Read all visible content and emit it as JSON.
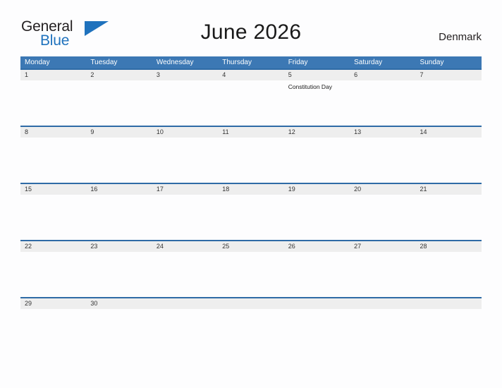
{
  "brand": {
    "line1": "General",
    "line2": "Blue",
    "flag_icon": "blue-flag-triangle-icon",
    "flag_color": "#1f72bd",
    "text_color": "#231f20"
  },
  "header": {
    "title": "June 2026",
    "country": "Denmark"
  },
  "theme": {
    "header_blue": "#3c78b4",
    "row_border_blue": "#2f6ba6",
    "band_gray": "#eeeeee",
    "page_background": "#fdfdfe"
  },
  "calendar": {
    "weekdays": [
      "Monday",
      "Tuesday",
      "Wednesday",
      "Thursday",
      "Friday",
      "Saturday",
      "Sunday"
    ],
    "weeks": [
      [
        {
          "day": "1",
          "event": ""
        },
        {
          "day": "2",
          "event": ""
        },
        {
          "day": "3",
          "event": ""
        },
        {
          "day": "4",
          "event": ""
        },
        {
          "day": "5",
          "event": "Constitution Day"
        },
        {
          "day": "6",
          "event": ""
        },
        {
          "day": "7",
          "event": ""
        }
      ],
      [
        {
          "day": "8",
          "event": ""
        },
        {
          "day": "9",
          "event": ""
        },
        {
          "day": "10",
          "event": ""
        },
        {
          "day": "11",
          "event": ""
        },
        {
          "day": "12",
          "event": ""
        },
        {
          "day": "13",
          "event": ""
        },
        {
          "day": "14",
          "event": ""
        }
      ],
      [
        {
          "day": "15",
          "event": ""
        },
        {
          "day": "16",
          "event": ""
        },
        {
          "day": "17",
          "event": ""
        },
        {
          "day": "18",
          "event": ""
        },
        {
          "day": "19",
          "event": ""
        },
        {
          "day": "20",
          "event": ""
        },
        {
          "day": "21",
          "event": ""
        }
      ],
      [
        {
          "day": "22",
          "event": ""
        },
        {
          "day": "23",
          "event": ""
        },
        {
          "day": "24",
          "event": ""
        },
        {
          "day": "25",
          "event": ""
        },
        {
          "day": "26",
          "event": ""
        },
        {
          "day": "27",
          "event": ""
        },
        {
          "day": "28",
          "event": ""
        }
      ],
      [
        {
          "day": "29",
          "event": ""
        },
        {
          "day": "30",
          "event": ""
        },
        {
          "day": "",
          "event": ""
        },
        {
          "day": "",
          "event": ""
        },
        {
          "day": "",
          "event": ""
        },
        {
          "day": "",
          "event": ""
        },
        {
          "day": "",
          "event": ""
        }
      ]
    ]
  }
}
